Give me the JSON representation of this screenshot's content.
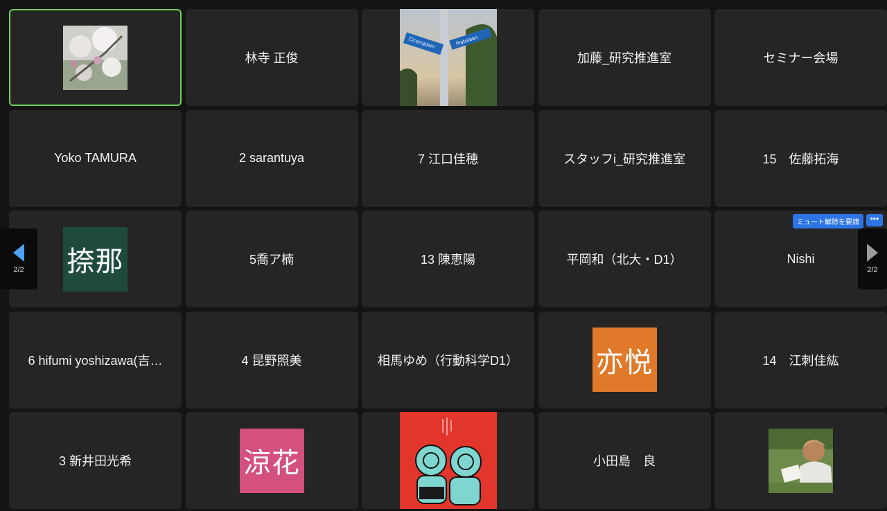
{
  "tiles": [
    {
      "type": "photo",
      "icon": "cherry-blossom-photo",
      "active": true
    },
    {
      "type": "name",
      "label": "林寺 正俊"
    },
    {
      "type": "photo",
      "icon": "street-sign-photo"
    },
    {
      "type": "name",
      "label": "加藤_研究推進室"
    },
    {
      "type": "name",
      "label": "セミナー会場"
    },
    {
      "type": "name",
      "label": "Yoko TAMURA"
    },
    {
      "type": "name",
      "label": "2 sarantuya"
    },
    {
      "type": "name",
      "label": "7 江口佳穂"
    },
    {
      "type": "name",
      "label": "スタッフi_研究推進室"
    },
    {
      "type": "name",
      "label": "15　佐藤拓海"
    },
    {
      "type": "avatar",
      "label": "捺那",
      "color": "#1f4b3e"
    },
    {
      "type": "name",
      "label": "5喬ア楠"
    },
    {
      "type": "name",
      "label": "13 陳恵陽"
    },
    {
      "type": "name",
      "label": "平岡和（北大・D1）"
    },
    {
      "type": "name",
      "label": "Nishi"
    },
    {
      "type": "name",
      "label": "6 hifumi yoshizawa(吉…"
    },
    {
      "type": "name",
      "label": "4 昆野照美"
    },
    {
      "type": "name",
      "label": "相馬ゆめ（行動科学D1）"
    },
    {
      "type": "avatar",
      "label": "亦悦",
      "color": "#e07a2a"
    },
    {
      "type": "name",
      "label": "14　江刺佳紘"
    },
    {
      "type": "name",
      "label": "3 新井田光希"
    },
    {
      "type": "avatar",
      "label": "涼花",
      "color": "#d4507f"
    },
    {
      "type": "photo",
      "icon": "illustrated-poster-photo"
    },
    {
      "type": "name",
      "label": "小田島　良"
    },
    {
      "type": "photo",
      "icon": "person-reading-photo"
    }
  ],
  "nishi_tile": {
    "unmute_request_label": "ミュート解除を要請",
    "more_label": "•••"
  },
  "pager": {
    "left_count": "2/2",
    "right_count": "2/2"
  },
  "colors": {
    "active_border": "#6fd35b",
    "accent": "#2d74e4"
  }
}
